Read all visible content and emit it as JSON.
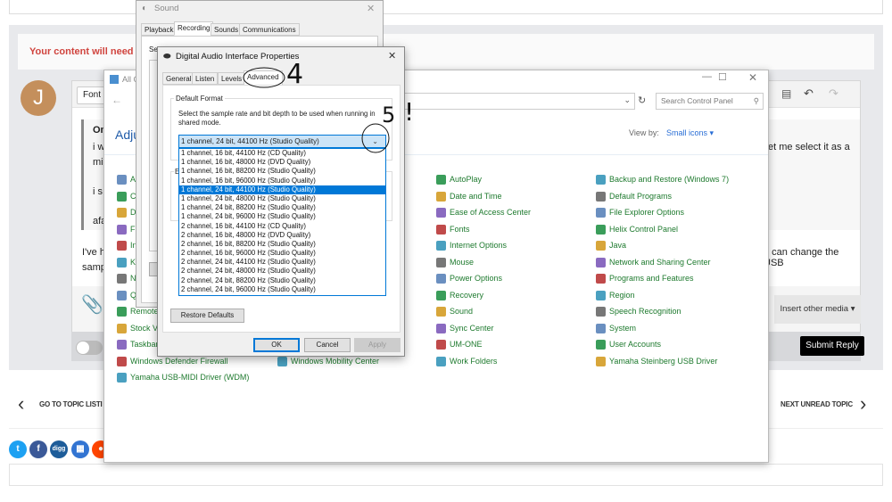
{
  "forum": {
    "warning": "Your content will need to",
    "avatar_letter": "J",
    "editor": {
      "font_label": "Font",
      "quote_lines": [
        "On",
        "i w",
        "mi",
        "i s",
        "afa"
      ],
      "quote_right": "et me select it as a",
      "body_lines": [
        "I've h",
        "samp"
      ],
      "body_right": "u can change the USB",
      "body_right2": ".",
      "insert_media": "Insert other media ▾"
    },
    "submit": "Submit Reply",
    "nav": {
      "prev": "GO TO TOPIC LISTI",
      "next": "NEXT UNREAD TOPIC"
    },
    "social": [
      "twitter",
      "facebook",
      "digg",
      "delicious",
      "reddit"
    ]
  },
  "control_panel": {
    "title": "All C",
    "heading": "Adju",
    "search_placeholder": "Search Control Panel",
    "view_by_label": "View by:",
    "view_by_value": "Small icons ▾",
    "col1": [
      "A",
      "Co",
      "De",
      "Fi",
      "In",
      "Ke",
      "NV",
      "Q",
      "Remote",
      "Stock Vi",
      "Taskbar",
      "Windows Defender Firewall",
      "Yamaha USB-MIDI Driver (WDM)"
    ],
    "col2": [
      "Windows Mobility Center"
    ],
    "col3": [
      "AutoPlay",
      "Date and Time",
      "Ease of Access Center",
      "Fonts",
      "Internet Options",
      "Mouse",
      "Power Options",
      "Recovery",
      "Sound",
      "Sync Center",
      "UM-ONE",
      "Work Folders"
    ],
    "col4": [
      "Backup and Restore (Windows 7)",
      "Default Programs",
      "File Explorer Options",
      "Helix Control Panel",
      "Java",
      "Network and Sharing Center",
      "Programs and Features",
      "Region",
      "Speech Recognition",
      "System",
      "User Accounts",
      "Yamaha Steinberg USB Driver"
    ]
  },
  "sound_dialog": {
    "title": "Sound",
    "tabs": [
      "Playback",
      "Recording",
      "Sounds",
      "Communications"
    ],
    "active_tab": "Recording",
    "sel": "Sele"
  },
  "props_dialog": {
    "title": "Digital Audio Interface Properties",
    "tabs": [
      "General",
      "Listen",
      "Levels",
      "Advanced"
    ],
    "active_tab": "Advanced",
    "group": "Default Format",
    "desc1": "Select the sample rate and bit depth to be used when running in",
    "desc2": "shared mode.",
    "selected": "1 channel, 24 bit, 44100 Hz (Studio Quality)",
    "options": [
      "1 channel, 16 bit, 44100 Hz (CD Quality)",
      "1 channel, 16 bit, 48000 Hz (DVD Quality)",
      "1 channel, 16 bit, 88200 Hz (Studio Quality)",
      "1 channel, 16 bit, 96000 Hz (Studio Quality)",
      "1 channel, 24 bit, 44100 Hz (Studio Quality)",
      "1 channel, 24 bit, 48000 Hz (Studio Quality)",
      "1 channel, 24 bit, 88200 Hz (Studio Quality)",
      "1 channel, 24 bit, 96000 Hz (Studio Quality)",
      "2 channel, 16 bit, 44100 Hz (CD Quality)",
      "2 channel, 16 bit, 48000 Hz (DVD Quality)",
      "2 channel, 16 bit, 88200 Hz (Studio Quality)",
      "2 channel, 16 bit, 96000 Hz (Studio Quality)",
      "2 channel, 24 bit, 44100 Hz (Studio Quality)",
      "2 channel, 24 bit, 48000 Hz (Studio Quality)",
      "2 channel, 24 bit, 88200 Hz (Studio Quality)",
      "2 channel, 24 bit, 96000 Hz (Studio Quality)"
    ],
    "group2": "E",
    "restore": "Restore Defaults",
    "ok": "OK",
    "cancel": "Cancel",
    "apply": "Apply"
  },
  "annotations": {
    "step4": "4",
    "step5": "5",
    "exclaim": "!"
  },
  "colors": {
    "accent": "#0078d7",
    "link_green": "#1e7a2e",
    "warning_red": "#d0443e"
  }
}
